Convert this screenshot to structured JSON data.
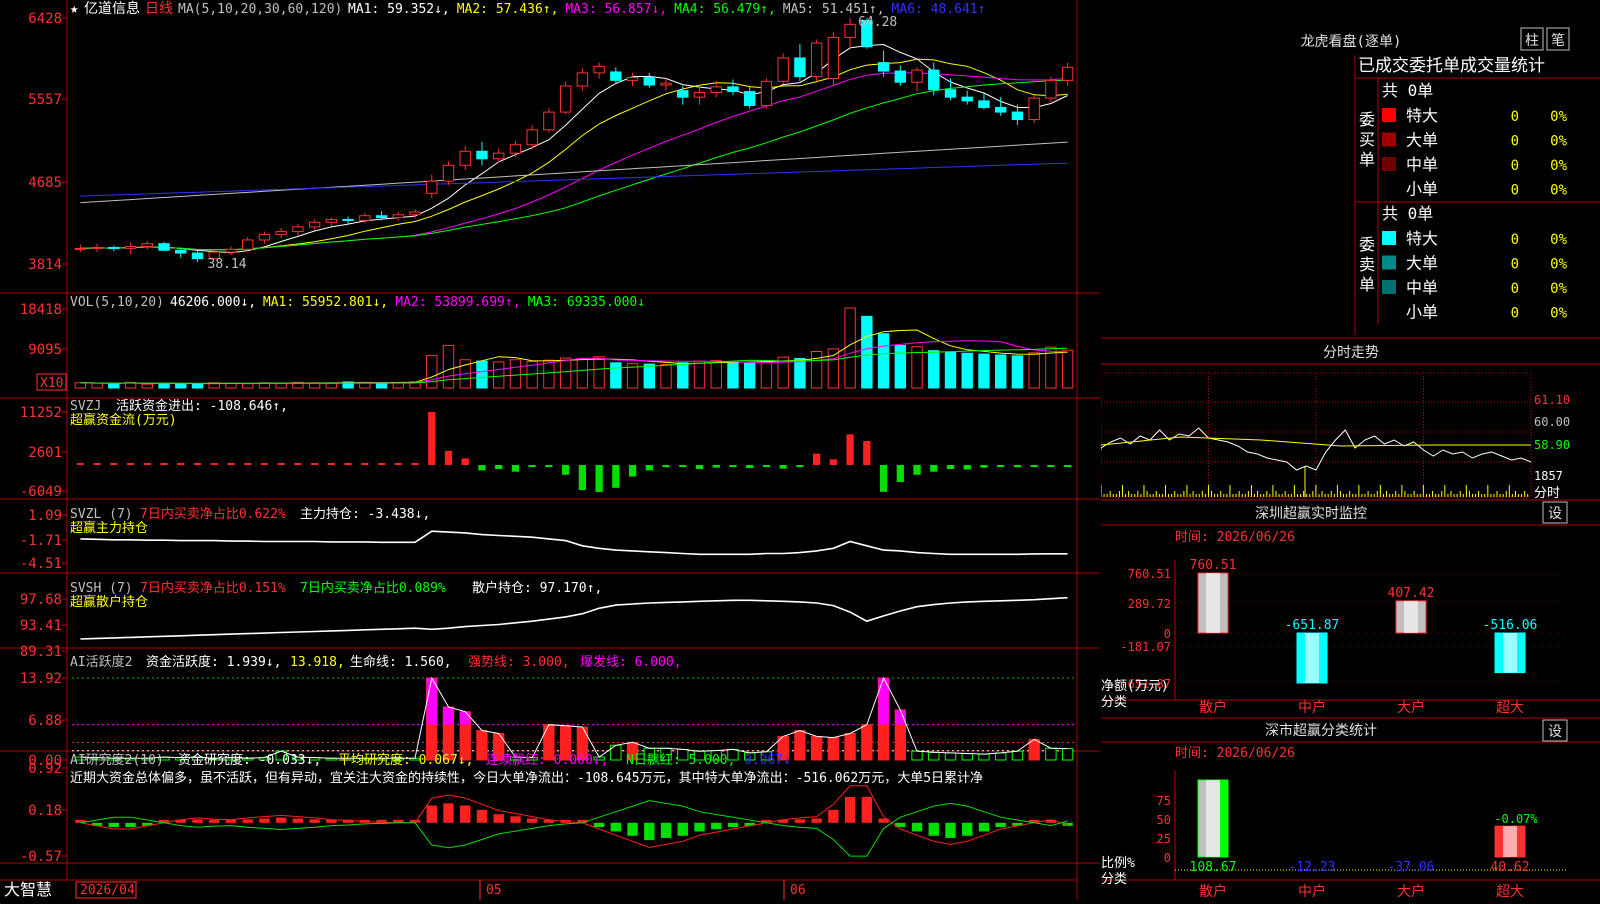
{
  "stock": {
    "name": "亿道信息",
    "period": "日线",
    "star": "★"
  },
  "bottom": {
    "brand": "大智慧",
    "date_start": "2026/04",
    "month_05": "05",
    "month_06": "06"
  },
  "panels": {
    "price": {
      "ma_label": "MA(5,10,20,30,60,120)",
      "legend": [
        {
          "text": "MA1: 59.352↓,",
          "color": "#ffffff"
        },
        {
          "text": "MA2: 57.436↑,",
          "color": "#ffff00"
        },
        {
          "text": "MA3: 56.857↓,",
          "color": "#ff00ff"
        },
        {
          "text": "MA4: 56.479↑,",
          "color": "#00ff00"
        },
        {
          "text": "MA5: 51.451↑,",
          "color": "#c0c0c0"
        },
        {
          "text": "MA6: 48.641↑",
          "color": "#3030ff"
        }
      ],
      "y_ticks": [
        "6428",
        "5557",
        "4685",
        "3814"
      ],
      "high_label": "64.28",
      "low_label": "38.14"
    },
    "vol": {
      "label": "VOL(5,10,20)",
      "legend": [
        {
          "text": "46206.000↓,",
          "color": "#ffffff"
        },
        {
          "text": "MA1: 55952.801↓,",
          "color": "#ffff00"
        },
        {
          "text": "MA2: 53899.699↑,",
          "color": "#ff00ff"
        },
        {
          "text": "MA3: 69335.000↓",
          "color": "#00ff00"
        }
      ],
      "y_ticks": [
        "18418",
        "9095"
      ],
      "unit": "X10"
    },
    "svzj": {
      "label": "SVZJ",
      "legend": "活跃资金进出: -108.646↑,",
      "subtitle": "超赢资金流(万元)",
      "y_ticks": [
        "11252",
        "2601",
        "-6049"
      ]
    },
    "svzl": {
      "label": "SVZL (7)",
      "legend1": "7日内买卖净占比0.622%",
      "legend2": "主力持仓: -3.438↓,",
      "subtitle": "超赢主力持仓",
      "y_ticks": [
        "1.09",
        "-1.71",
        "-4.51"
      ]
    },
    "svsh": {
      "label": "SVSH (7)",
      "legend1": "7日内买卖净占比0.151%",
      "legend2": "7日内买卖净占比0.089%",
      "legend3": "散户持仓: 97.170↑,",
      "subtitle": "超赢散户持仓",
      "y_ticks": [
        "97.68",
        "93.41",
        "89.31"
      ]
    },
    "ai1": {
      "label": "AI活跃度2",
      "legend1": "资金活跃度: 1.939↓,",
      "legend2": "13.918,",
      "legend3": "生命线: 1.560,",
      "legend4": "强势线: 3.000,",
      "legend5": "爆发线: 6.000,",
      "y_ticks": [
        "13.92",
        "6.88",
        "0.00"
      ]
    },
    "ai2": {
      "label": "AI研究度2(10)",
      "legend1": "资金研究度: -0.033↓,",
      "legend2": "平均研究度: 0.067↓,",
      "legend3": "连续飘红: 0.000↓,",
      "legend4": "N日飘红: 5.000,",
      "legend5": "0.067↓",
      "comment": "近期大资金总体偏多，虽不活跃，但有异动，宜关注大资金的持续性，今日大单净流出：-108.645万元，其中特大单净流出：-516.062万元，大单5日累计净",
      "y_ticks": [
        "0.92",
        "0.18",
        "-0.57"
      ]
    }
  },
  "side": {
    "dragon_title": "龙虎看盘(逐单)",
    "btn_bar": "柱",
    "btn_pen": "笔",
    "stats_title": "已成交委托单成交量统计",
    "buy_label": "委买单",
    "sell_label": "委卖单",
    "buy_total": "共 0单",
    "sell_total": "共 0单",
    "buy_rows": [
      {
        "name": "特大",
        "count": "0",
        "pct": "0%",
        "color": "#ff0000"
      },
      {
        "name": "大单",
        "count": "0",
        "pct": "0%",
        "color": "#a00000"
      },
      {
        "name": "中单",
        "count": "0",
        "pct": "0%",
        "color": "#700000"
      },
      {
        "name": "小单",
        "count": "0",
        "pct": "0%",
        "color": ""
      }
    ],
    "sell_rows": [
      {
        "name": "特大",
        "count": "0",
        "pct": "0%",
        "color": "#00ffff"
      },
      {
        "name": "大单",
        "count": "0",
        "pct": "0%",
        "color": "#008b8b"
      },
      {
        "name": "中单",
        "count": "0",
        "pct": "0%",
        "color": "#007070"
      },
      {
        "name": "小单",
        "count": "0",
        "pct": "0%",
        "color": ""
      }
    ],
    "intraday_title": "分时走势",
    "intraday_ticks": [
      "61.10",
      "60.00",
      "58.90"
    ],
    "intraday_vol": "1857",
    "intraday_unit": "分时",
    "monitor_title": "深圳超赢实时监控",
    "monitor_btn": "设",
    "monitor_time": "时间: 2026/06/26",
    "monitor_axis_label1": "净额(万元)",
    "monitor_axis_label2": "分类",
    "monitor_y_ticks": [
      "760.51",
      "289.72",
      "0",
      "-181.07",
      "-651.87"
    ],
    "class_title": "深市超赢分类统计",
    "class_btn": "设",
    "class_time": "时间: 2026/06/26",
    "class_axis_label1": "比例%",
    "class_axis_label2": "分类",
    "class_y_ticks": [
      "75",
      "50",
      "25",
      "0"
    ],
    "class_extra_label": "-0.07%"
  },
  "chart_data": [
    {
      "type": "candlestick",
      "title": "亿道信息 日线",
      "categories_count": 60,
      "ohlc": [
        [
          39.5,
          40.0,
          39.2,
          39.6
        ],
        [
          39.6,
          40.1,
          39.2,
          39.7
        ],
        [
          39.7,
          39.9,
          39.3,
          39.6
        ],
        [
          39.6,
          40.2,
          39.0,
          39.8
        ],
        [
          39.8,
          40.4,
          39.5,
          40.1
        ],
        [
          40.1,
          40.3,
          39.3,
          39.4
        ],
        [
          39.4,
          39.6,
          38.6,
          39.1
        ],
        [
          39.1,
          39.3,
          38.14,
          38.5
        ],
        [
          38.5,
          39.4,
          38.4,
          39.2
        ],
        [
          39.2,
          39.8,
          38.9,
          39.5
        ],
        [
          39.5,
          40.8,
          39.4,
          40.5
        ],
        [
          40.5,
          41.4,
          40.1,
          41.1
        ],
        [
          41.1,
          41.8,
          40.7,
          41.4
        ],
        [
          41.4,
          42.2,
          41.0,
          41.9
        ],
        [
          41.9,
          42.7,
          41.6,
          42.4
        ],
        [
          42.4,
          42.9,
          42.0,
          42.7
        ],
        [
          42.7,
          43.0,
          42.2,
          42.6
        ],
        [
          42.6,
          43.4,
          42.3,
          43.1
        ],
        [
          43.1,
          43.6,
          42.6,
          42.9
        ],
        [
          42.9,
          43.5,
          42.6,
          43.2
        ],
        [
          43.2,
          43.8,
          42.8,
          43.5
        ],
        [
          45.5,
          47.5,
          45.0,
          46.8
        ],
        [
          46.8,
          48.9,
          46.4,
          48.5
        ],
        [
          48.5,
          50.6,
          48.0,
          50.0
        ],
        [
          50.0,
          51.0,
          48.5,
          49.2
        ],
        [
          49.2,
          50.3,
          48.8,
          49.8
        ],
        [
          49.8,
          51.1,
          49.4,
          50.7
        ],
        [
          50.7,
          52.8,
          50.2,
          52.3
        ],
        [
          52.3,
          54.6,
          52.0,
          54.2
        ],
        [
          54.2,
          57.5,
          54.0,
          57.0
        ],
        [
          57.0,
          58.9,
          56.5,
          58.4
        ],
        [
          58.4,
          59.5,
          57.8,
          59.1
        ],
        [
          58.5,
          59.0,
          57.2,
          57.6
        ],
        [
          57.6,
          58.4,
          57.0,
          57.9
        ],
        [
          57.9,
          58.4,
          56.8,
          57.1
        ],
        [
          57.1,
          57.8,
          56.5,
          57.3
        ],
        [
          56.5,
          57.0,
          55.0,
          55.8
        ],
        [
          55.8,
          57.0,
          55.0,
          56.3
        ],
        [
          56.3,
          57.5,
          55.8,
          56.9
        ],
        [
          56.9,
          57.7,
          56.0,
          56.4
        ],
        [
          56.4,
          57.0,
          54.6,
          54.9
        ],
        [
          54.9,
          57.8,
          54.6,
          57.5
        ],
        [
          57.5,
          60.5,
          57.2,
          60.0
        ],
        [
          60.0,
          61.5,
          57.5,
          58.0
        ],
        [
          58.0,
          62.0,
          57.5,
          61.6
        ],
        [
          57.8,
          62.8,
          57.0,
          62.2
        ],
        [
          62.2,
          64.28,
          61.0,
          63.6
        ],
        [
          64.0,
          64.28,
          61.0,
          61.2
        ],
        [
          59.5,
          60.8,
          58.0,
          58.6
        ],
        [
          58.6,
          59.2,
          57.0,
          57.4
        ],
        [
          57.4,
          59.0,
          56.4,
          58.7
        ],
        [
          58.7,
          59.5,
          56.0,
          56.6
        ],
        [
          56.6,
          57.8,
          55.5,
          55.8
        ],
        [
          55.8,
          56.5,
          55.0,
          55.4
        ],
        [
          55.4,
          56.2,
          54.5,
          54.7
        ],
        [
          54.7,
          55.8,
          53.8,
          54.2
        ],
        [
          54.2,
          55.0,
          52.8,
          53.4
        ],
        [
          53.4,
          56.0,
          53.0,
          55.7
        ],
        [
          55.7,
          58.0,
          55.3,
          57.6
        ],
        [
          57.6,
          59.5,
          57.0,
          59.0
        ]
      ],
      "volume_x10": [
        1200,
        1100,
        1000,
        1300,
        900,
        1100,
        1000,
        900,
        1200,
        1100,
        1000,
        1200,
        1100,
        1300,
        1200,
        1100,
        1400,
        1300,
        1200,
        1300,
        1400,
        7500,
        9800,
        6500,
        6200,
        6000,
        6500,
        6100,
        6400,
        6900,
        6800,
        7200,
        5800,
        5600,
        5500,
        5400,
        5800,
        6200,
        6300,
        6000,
        5700,
        6100,
        7100,
        6800,
        8400,
        9000,
        18418,
        16500,
        12500,
        9800,
        9500,
        8600,
        8200,
        8000,
        7800,
        7600,
        7400,
        8100,
        9400,
        8700
      ]
    },
    {
      "type": "bar",
      "name": "SVZJ 活跃资金进出 (万元)",
      "ylim": [
        -6049,
        11252
      ],
      "values": [
        0,
        0,
        0,
        0,
        0,
        0,
        0,
        0,
        0,
        0,
        0,
        0,
        0,
        0,
        0,
        0,
        0,
        0,
        0,
        0,
        0,
        11252,
        3000,
        1400,
        -1200,
        -900,
        -1500,
        -200,
        -400,
        -2200,
        -5600,
        -6049,
        -5100,
        -2600,
        -1200,
        -500,
        -400,
        -900,
        -600,
        -300,
        -700,
        -400,
        -800,
        -300,
        2400,
        1200,
        6500,
        5100,
        -6000,
        -3800,
        -2200,
        -1500,
        -900,
        -1000,
        -600,
        -400,
        -500,
        -400,
        -300,
        -108.646
      ]
    },
    {
      "type": "line",
      "name": "SVZL 主力持仓",
      "ylim": [
        -4.51,
        1.09
      ],
      "values": [
        -1.7,
        -1.75,
        -1.8,
        -1.8,
        -1.85,
        -1.85,
        -1.9,
        -1.9,
        -1.9,
        -1.95,
        -1.95,
        -2.0,
        -2.0,
        -2.0,
        -2.0,
        -2.05,
        -2.05,
        -2.05,
        -2.1,
        -2.1,
        -2.1,
        -0.8,
        -0.9,
        -1.0,
        -1.2,
        -1.3,
        -1.4,
        -1.5,
        -1.7,
        -1.9,
        -2.5,
        -2.8,
        -3.0,
        -3.1,
        -3.2,
        -3.3,
        -3.4,
        -3.5,
        -3.5,
        -3.5,
        -3.5,
        -3.4,
        -3.4,
        -3.3,
        -3.1,
        -2.8,
        -2.0,
        -2.5,
        -3.0,
        -3.1,
        -3.3,
        -3.4,
        -3.5,
        -3.5,
        -3.5,
        -3.5,
        -3.5,
        -3.45,
        -3.44,
        -3.438
      ]
    },
    {
      "type": "line",
      "name": "SVSH 散户持仓",
      "ylim": [
        89.31,
        97.68
      ],
      "values": [
        89.5,
        89.6,
        89.7,
        89.8,
        89.9,
        90.0,
        90.1,
        90.2,
        90.3,
        90.4,
        90.5,
        90.6,
        90.7,
        90.8,
        90.9,
        91.0,
        91.1,
        91.2,
        91.3,
        91.4,
        91.5,
        91.3,
        91.5,
        91.8,
        92.0,
        92.2,
        92.5,
        92.8,
        93.2,
        93.6,
        94.2,
        95.2,
        95.8,
        96.0,
        96.2,
        96.3,
        96.4,
        96.5,
        96.6,
        96.7,
        96.7,
        96.6,
        96.5,
        96.4,
        96.2,
        95.7,
        94.5,
        92.8,
        93.8,
        94.7,
        95.5,
        95.9,
        96.2,
        96.4,
        96.5,
        96.6,
        96.7,
        96.8,
        97.0,
        97.17
      ]
    },
    {
      "type": "bar",
      "name": "AI活跃度2 资金活跃度",
      "ylim": [
        0,
        13.92
      ],
      "values": [
        0.5,
        0.4,
        0.3,
        0.3,
        0.3,
        0.5,
        0.4,
        0.5,
        0.3,
        0.4,
        0.3,
        0.4,
        1.5,
        0.5,
        0.4,
        0.3,
        0.3,
        0.3,
        0.3,
        0.3,
        0.3,
        13.92,
        9.0,
        8.2,
        5.0,
        4.5,
        0.5,
        0.4,
        6.0,
        5.8,
        5.6,
        0.5,
        2.5,
        3.0,
        2.0,
        2.0,
        1.8,
        1.5,
        1.6,
        1.8,
        1.2,
        1.4,
        4.0,
        5.0,
        4.0,
        3.8,
        4.5,
        6.0,
        13.92,
        8.5,
        1.5,
        1.3,
        1.2,
        1.1,
        1.0,
        1.2,
        1.5,
        3.5,
        2.0,
        1.939
      ]
    },
    {
      "type": "line",
      "name": "AI研究度2(10) 资金研究度",
      "ylim": [
        -0.57,
        0.92
      ],
      "values": [
        0.0,
        -0.05,
        -0.1,
        -0.1,
        -0.05,
        0.0,
        0.05,
        0.08,
        0.06,
        0.05,
        0.08,
        0.1,
        0.12,
        0.1,
        0.08,
        0.05,
        0.04,
        0.02,
        0.01,
        0.0,
        0.0,
        0.4,
        0.45,
        0.4,
        0.3,
        0.2,
        0.15,
        0.1,
        0.05,
        0.02,
        0.0,
        -0.1,
        -0.2,
        -0.3,
        -0.4,
        -0.35,
        -0.3,
        -0.2,
        -0.15,
        -0.1,
        -0.05,
        0.0,
        0.05,
        0.08,
        0.1,
        0.3,
        0.6,
        0.6,
        0.1,
        -0.1,
        -0.2,
        -0.3,
        -0.35,
        -0.3,
        -0.2,
        -0.1,
        -0.05,
        0.0,
        0.05,
        -0.033
      ]
    },
    {
      "type": "bar",
      "name": "深圳超赢实时监控 净额(万元)",
      "categories": [
        "散户",
        "中户",
        "大户",
        "超大"
      ],
      "values": [
        760.51,
        -651.87,
        407.42,
        -516.06
      ],
      "ylim": [
        -651.87,
        760.51
      ]
    },
    {
      "type": "bar",
      "name": "深市超赢分类统计 比例%",
      "categories": [
        "散户",
        "中户",
        "大户",
        "超大"
      ],
      "values": [
        108.67,
        -12.23,
        -37.06,
        40.62
      ],
      "ylim": [
        0,
        75
      ]
    }
  ]
}
